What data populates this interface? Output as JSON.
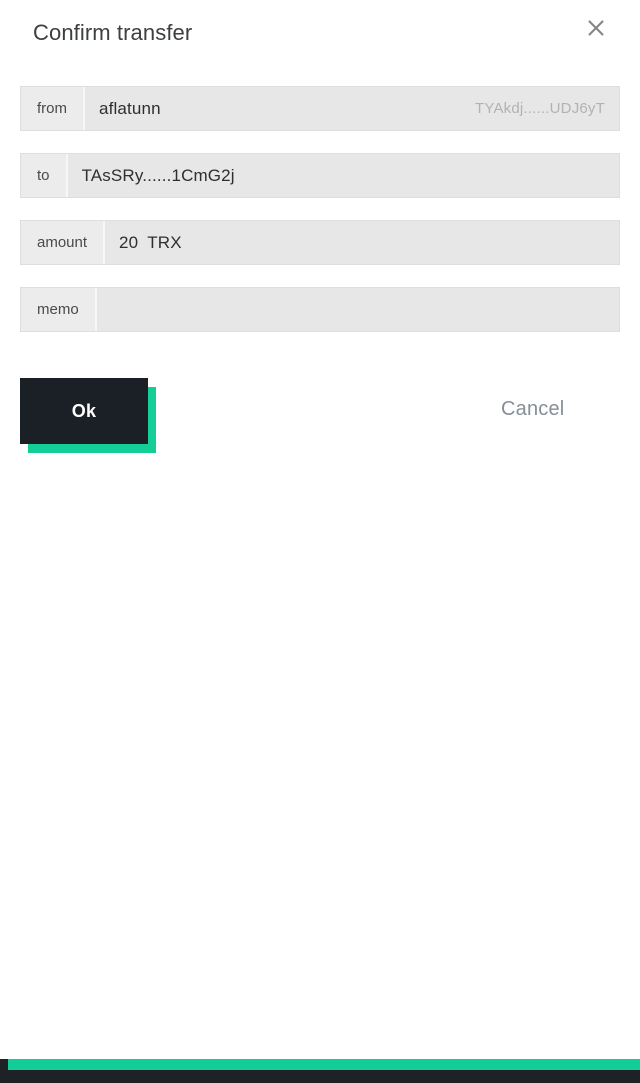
{
  "dialog": {
    "title": "Confirm transfer",
    "close_icon": "close-icon"
  },
  "form": {
    "rows": [
      {
        "label": "from",
        "value": "aflatunn",
        "aux": "TYAkdj......UDJ6yT"
      },
      {
        "label": "to",
        "value": "TAsSRy......1CmG2j",
        "aux": ""
      },
      {
        "label": "amount",
        "value": "20",
        "unit": "TRX"
      },
      {
        "label": "memo",
        "value": "",
        "aux": ""
      }
    ]
  },
  "actions": {
    "ok_label": "Ok",
    "cancel_label": "Cancel"
  },
  "colors": {
    "accent": "#13cd99",
    "button_dark": "#1b2026",
    "row_value_bg": "#e7e7e7",
    "row_label_bg": "#ececec",
    "title_text": "#3c4043",
    "muted_text": "#b2b2b2",
    "cancel_text": "#868e96",
    "system_bar": "#1e2126"
  }
}
